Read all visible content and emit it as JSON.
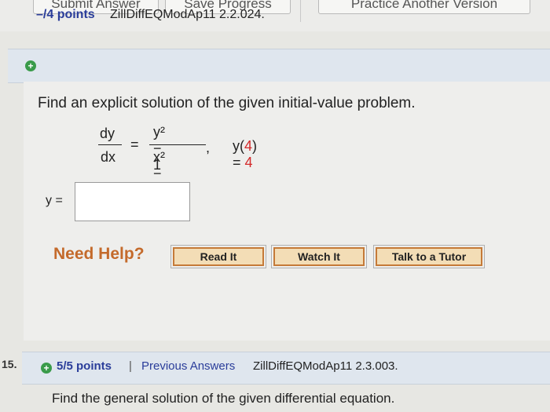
{
  "toolbar": {
    "submit_label": "Submit Answer",
    "save_label": "Save Progress",
    "practice_label": "Practice Another Version"
  },
  "question14": {
    "points": "–/4 points",
    "id": "ZillDiffEQModAp11 2.2.024.",
    "prompt": "Find an explicit solution of the given initial-value problem.",
    "equation": {
      "lhs_num": "dy",
      "lhs_den": "dx",
      "equals": "=",
      "rhs_num": "y² − 1",
      "rhs_den": "x² − 1",
      "comma": ",",
      "cond_prefix": "y(",
      "cond_arg": "4",
      "cond_mid": ") = ",
      "cond_value": "4"
    },
    "answer_label": "y =",
    "answer_value": "",
    "help": {
      "title": "Need Help?",
      "read": "Read It",
      "watch": "Watch It",
      "tutor": "Talk to a Tutor"
    }
  },
  "question15": {
    "number": "15.",
    "points": "5/5 points",
    "separator": "|",
    "previous": "Previous Answers",
    "id": "ZillDiffEQModAp11 2.3.003.",
    "prompt": "Find the general solution of the given differential equation."
  },
  "colors": {
    "points": "#2a3d9a",
    "need_help": "#c46a2b",
    "initial_value": "#d3292a",
    "plus_icon": "#3a9b4a"
  }
}
